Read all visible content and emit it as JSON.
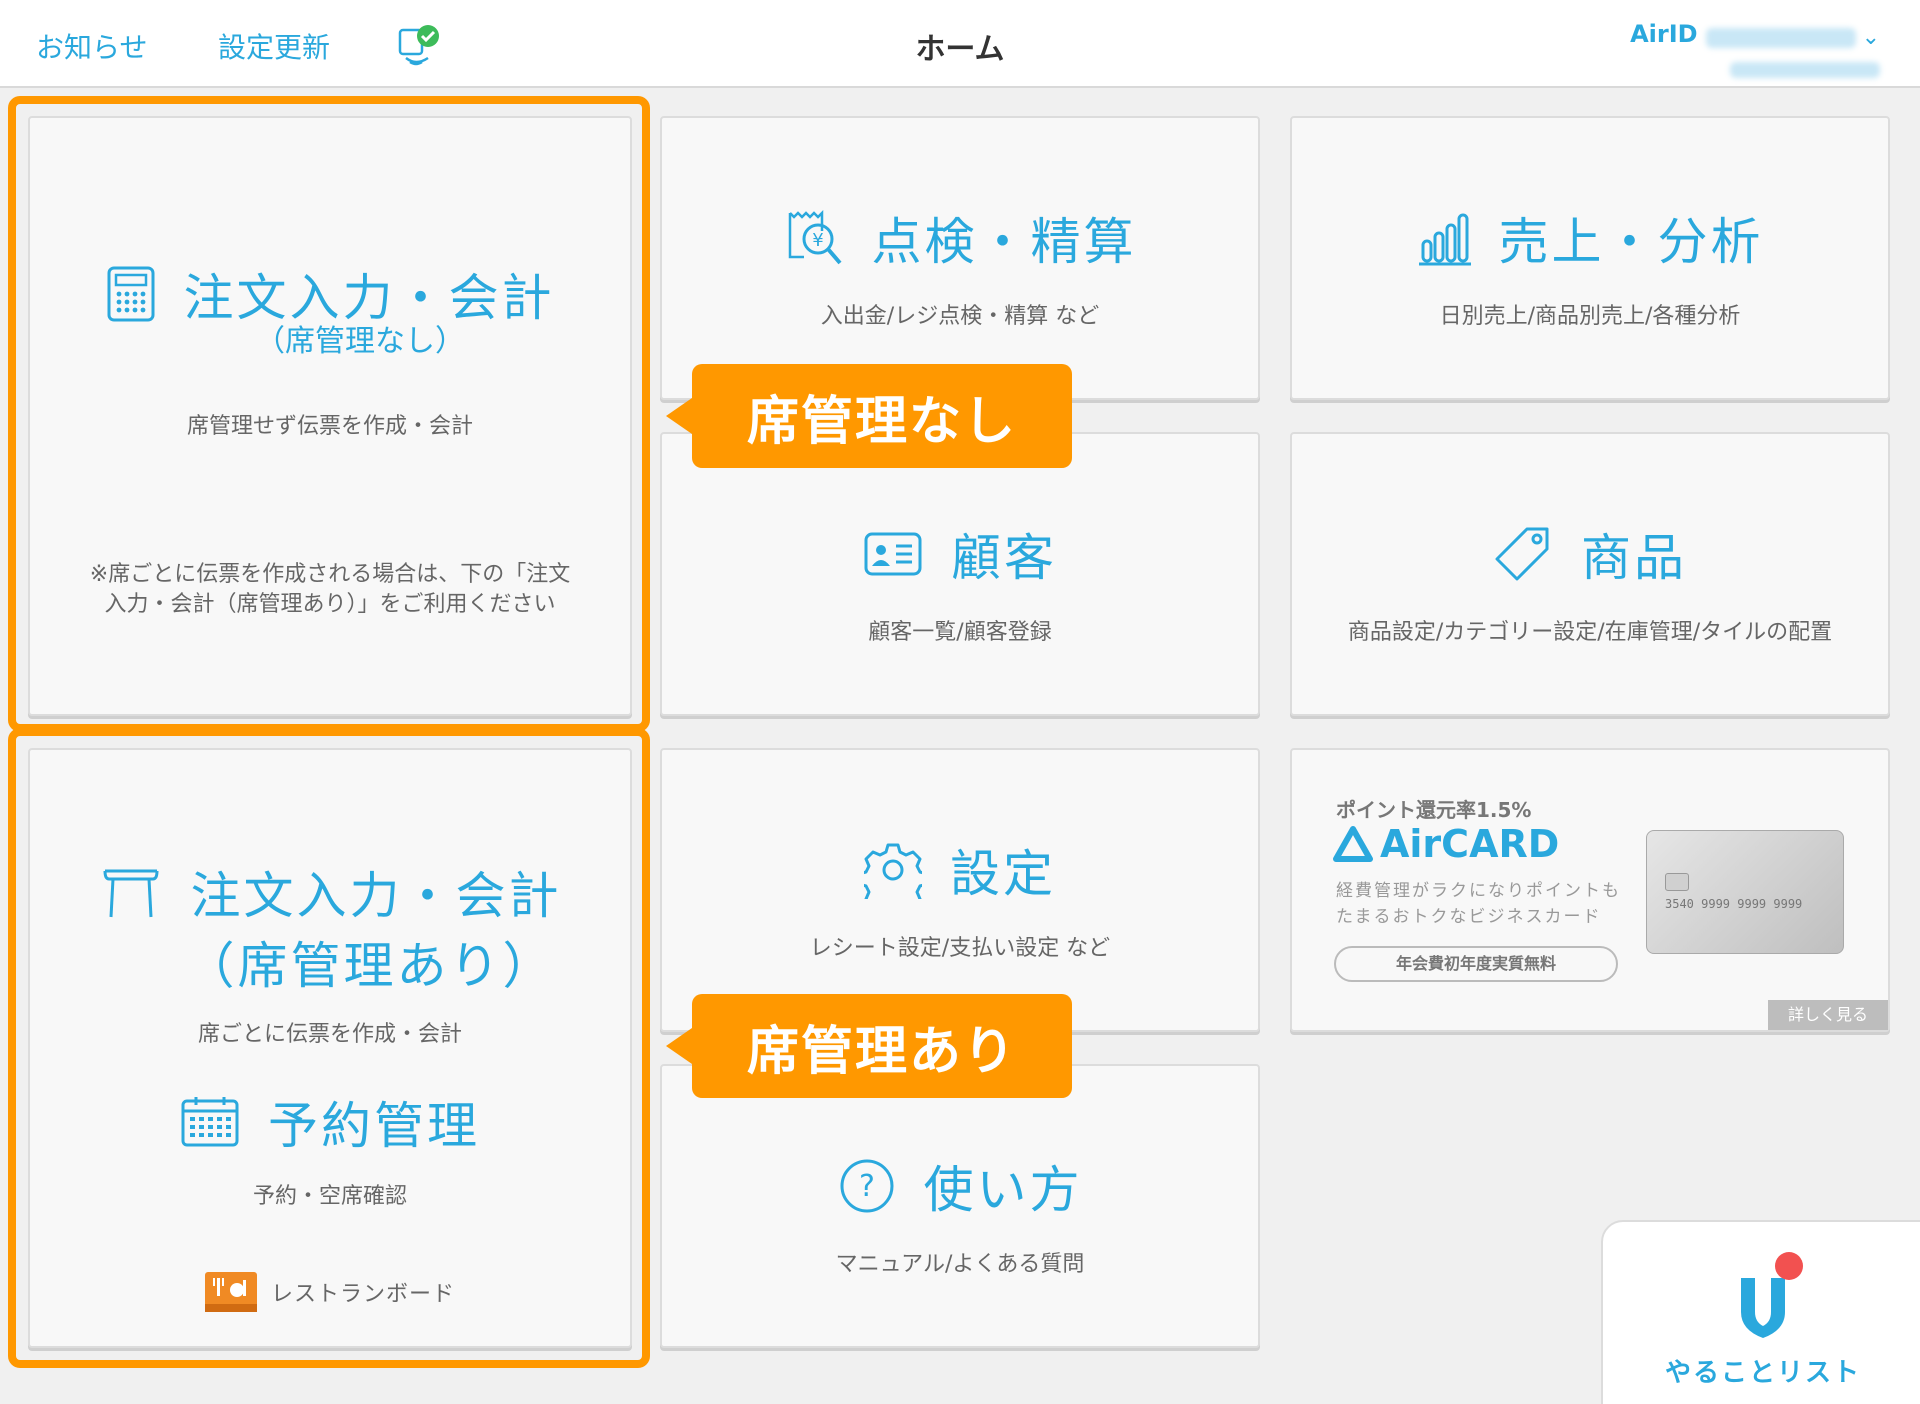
{
  "header": {
    "news": "お知らせ",
    "settings_update": "設定更新",
    "title": "ホーム",
    "airid_label": "AirID",
    "sync_icon": "sync-check-icon"
  },
  "tiles": {
    "order_no_seat": {
      "title": "注文入力・会計",
      "title_sub": "（席管理なし）",
      "desc": "席管理せず伝票を作成・会計",
      "note_line1": "※席ごとに伝票を作成される場合は、下の「注文",
      "note_line2": "入力・会計（席管理あり）」をご利用ください"
    },
    "inspect": {
      "title": "点検・精算",
      "desc": "入出金/レジ点検・精算 など"
    },
    "sales": {
      "title": "売上・分析",
      "desc": "日別売上/商品別売上/各種分析"
    },
    "customer": {
      "title": "顧客",
      "desc": "顧客一覧/顧客登録"
    },
    "product": {
      "title": "商品",
      "desc": "商品設定/カテゴリー設定/在庫管理/タイルの配置"
    },
    "order_seat": {
      "title": "注文入力・会計",
      "title_sub": "（席管理あり）",
      "desc": "席ごとに伝票を作成・会計"
    },
    "reservation": {
      "title": "予約管理",
      "desc": "予約・空席確認",
      "board": "レストランボード"
    },
    "settings": {
      "title": "設定",
      "desc": "レシート設定/支払い設定 など"
    },
    "help": {
      "title": "使い方",
      "desc": "マニュアル/よくある質問"
    }
  },
  "ad": {
    "point": "ポイント還元率1.5%",
    "brand": "AirCARD",
    "desc_line1": "経費管理がラクになりポイントも",
    "desc_line2": "たまるおトクなビジネスカード",
    "fee": "年会費初年度実質無料",
    "more": "詳しく見る",
    "card_number": "3540 9999 9999 9999"
  },
  "callouts": {
    "no_seat": "席管理なし",
    "seat": "席管理あり"
  },
  "todo": {
    "label": "やることリスト"
  },
  "colors": {
    "accent": "#2aa8dd",
    "highlight": "#ff9800",
    "badge": "#f25150"
  }
}
